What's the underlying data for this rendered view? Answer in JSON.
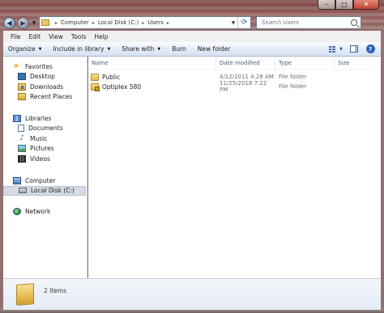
{
  "window": {
    "caption_buttons": [
      "minimize",
      "maximize",
      "close"
    ]
  },
  "address": {
    "crumbs": [
      "Computer",
      "Local Disk (C:)",
      "Users"
    ],
    "search_placeholder": "Search Users"
  },
  "menu": [
    "File",
    "Edit",
    "View",
    "Tools",
    "Help"
  ],
  "commands": {
    "organize": "Organize",
    "include": "Include in library",
    "share": "Share with",
    "burn": "Burn",
    "new_folder": "New folder"
  },
  "nav": {
    "favorites": "Favorites",
    "desktop": "Desktop",
    "downloads": "Downloads",
    "recent": "Recent Places",
    "libraries": "Libraries",
    "documents": "Documents",
    "music": "Music",
    "pictures": "Pictures",
    "videos": "Videos",
    "computer": "Computer",
    "local_disk": "Local Disk (C:)",
    "network": "Network"
  },
  "columns": {
    "name": "Name",
    "date": "Date modified",
    "type": "Type",
    "size": "Size"
  },
  "files": [
    {
      "name": "Public",
      "date": "4/12/2011 4:28 AM",
      "type": "File folder"
    },
    {
      "name": "Optiplex 580",
      "date": "11/25/2018 7:22 PM",
      "type": "File folder"
    }
  ],
  "details": {
    "count": "2 items"
  },
  "colors": {
    "accent": "#2d64b8",
    "selection": "#d4dbe4",
    "folder": "#e2b84a"
  }
}
